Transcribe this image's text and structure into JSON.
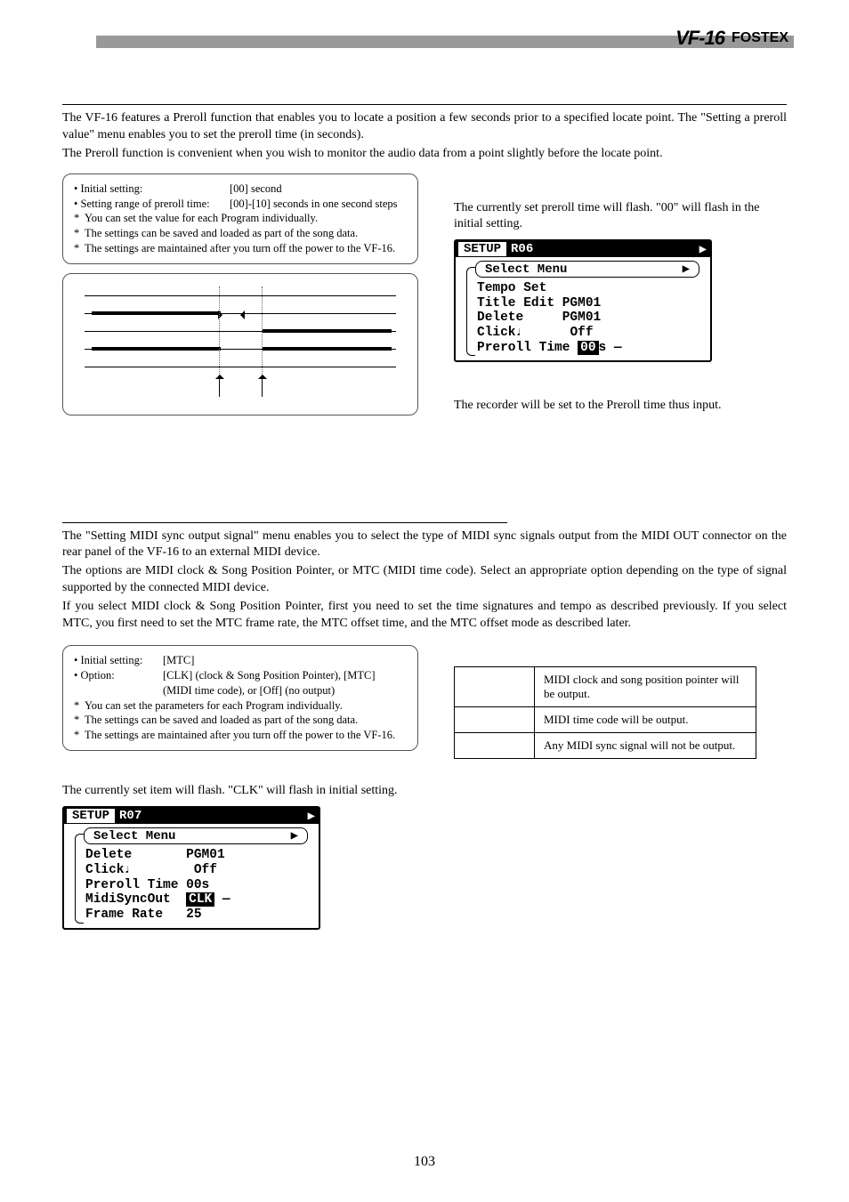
{
  "brand": {
    "model": "VF-16",
    "company": "FOSTEX"
  },
  "preroll": {
    "intro1": "The VF-16 features a Preroll function that enables you to locate a position a few seconds prior to a specified locate point.  The \"Setting a preroll value\" menu enables you to set the preroll time (in seconds).",
    "intro2": "The Preroll function is convenient when you wish to monitor the audio data from a point slightly before the locate point.",
    "box": {
      "initial_label": "Initial setting:",
      "initial_value": "[00] second",
      "range_label": "Setting range of preroll time:",
      "range_value": "[00]-[10] seconds in one second steps",
      "note1": "You can set the value for each Program individually.",
      "note2": "The settings can be saved and loaded as part of the song data.",
      "note3": "The settings are maintained after you turn off the power to the VF-16."
    },
    "right_text1": "The currently set preroll time will flash.  \"00\" will flash in the initial setting.",
    "right_text2": "The recorder will be set to the Preroll time thus input.",
    "lcd": {
      "tab_left": "SETUP",
      "tab_right": "R06",
      "select": "Select Menu",
      "line1": "Tempo Set",
      "line2a": "Title Edit",
      "line2b": "PGM01",
      "line3a": "Delete",
      "line3b": "PGM01",
      "line4a": "Click♩",
      "line4b": "Off",
      "line5a": "Preroll Time",
      "line5b": "00",
      "line5c": "s"
    }
  },
  "midisync": {
    "intro1": "The \"Setting MIDI sync output signal\" menu enables you to select the type of MIDI sync signals output from the MIDI OUT connector on the rear panel of the VF-16 to an external MIDI device.",
    "intro2": "The options are MIDI clock & Song Position Pointer, or MTC (MIDI time code).  Select an appropriate option depending on the type of signal supported by the connected MIDI device.",
    "intro3": "If you select MIDI clock & Song Position Pointer, first you need to set the time signatures and tempo as described previously.  If you select MTC, you first need to set the MTC frame rate, the MTC offset time, and the MTC offset mode as described later.",
    "box": {
      "initial_label": "Initial setting:",
      "initial_value": "[MTC]",
      "option_label": "Option:",
      "option_value": "[CLK] (clock & Song Position Pointer), [MTC] (MIDI time code), or [Off] (no output)",
      "note1": "You can set the parameters for each Program individually.",
      "note2": "The settings can be saved and loaded as part of the song data.",
      "note3": "The settings are maintained after you turn off the power to the VF-16."
    },
    "table": {
      "r1": "MIDI clock and song position pointer will be output.",
      "r2": "MIDI time code will be output.",
      "r3": "Any MIDI sync signal will not be output."
    },
    "step_text": "The currently set item will flash.  \"CLK\" will flash in initial setting.",
    "lcd": {
      "tab_left": "SETUP",
      "tab_right": "R07",
      "select": "Select Menu",
      "line1a": "Delete",
      "line1b": "PGM01",
      "line2a": "Click♩",
      "line2b": "Off",
      "line3a": "Preroll Time",
      "line3b": "00s",
      "line4a": "MidiSyncOut",
      "line4b": "CLK",
      "line5a": "Frame Rate",
      "line5b": "25"
    }
  },
  "page_number": "103"
}
